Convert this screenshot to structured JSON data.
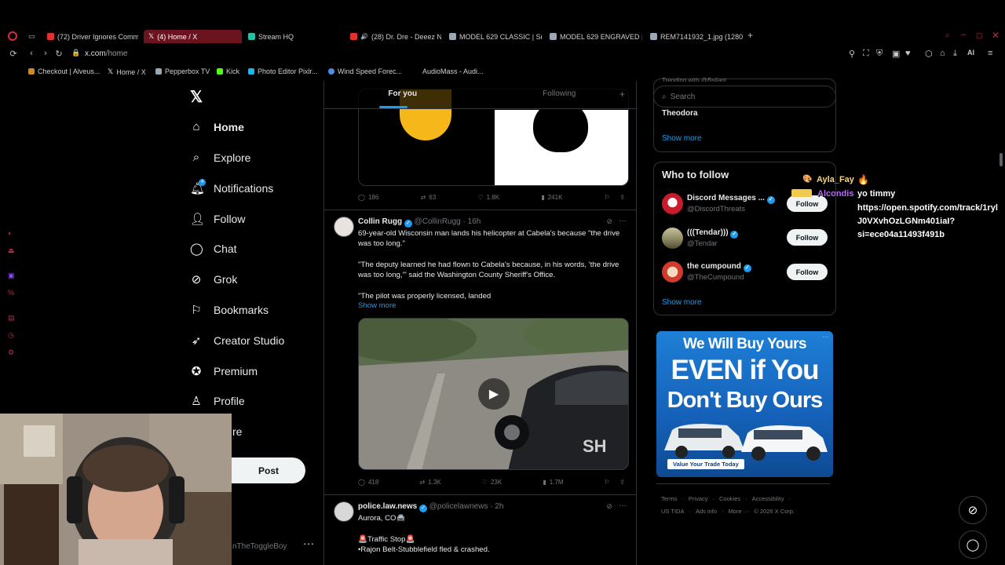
{
  "browser": {
    "tabs": [
      {
        "label": "(72) Driver Ignores Comma",
        "favicon_color": "#e5312d"
      },
      {
        "label": "(4) Home / X",
        "favicon_color": "#ffffff"
      },
      {
        "label": "Stream HQ",
        "favicon_color": "#26c1a5"
      },
      {
        "label": "(28) Dr. Dre - Deeez N",
        "favicon_color": "#e5312d"
      },
      {
        "label": "MODEL 629 CLASSIC | Sm",
        "favicon_color": "#9aa7b5"
      },
      {
        "label": "MODEL 629 ENGRAVED | S",
        "favicon_color": "#9aa7b5"
      },
      {
        "label": "REM7141932_1.jpg (1280×7",
        "favicon_color": "#9aa7b5"
      }
    ],
    "new_tab": "+",
    "address_host": "x.com",
    "address_path": "/home",
    "bookmarks": [
      {
        "label": "Checkout | Alveus...",
        "favicon_color": "#c98a2b"
      },
      {
        "label": "Home / X",
        "favicon_color": "#ffffff"
      },
      {
        "label": "Pepperbox TV",
        "favicon_color": "#9aa7b5"
      },
      {
        "label": "Kick",
        "favicon_color": "#53fc18"
      },
      {
        "label": "Photo Editor Pixlr...",
        "favicon_color": "#1bb5e8"
      },
      {
        "label": "Wind Speed Forec...",
        "favicon_color": "#4a90e2"
      },
      {
        "label": "AudioMass - Audi...",
        "favicon_color": "#000000"
      }
    ],
    "ai_label": "AI"
  },
  "nav": {
    "items": [
      {
        "label": "Home",
        "icon": "home-icon"
      },
      {
        "label": "Explore",
        "icon": "search-icon"
      },
      {
        "label": "Notifications",
        "icon": "bell-icon"
      },
      {
        "label": "Follow",
        "icon": "add-user-icon"
      },
      {
        "label": "Chat",
        "icon": "chat-icon"
      },
      {
        "label": "Grok",
        "icon": "grok-icon"
      },
      {
        "label": "Bookmarks",
        "icon": "bookmark-icon"
      },
      {
        "label": "Creator Studio",
        "icon": "rocket-icon"
      },
      {
        "label": "Premium",
        "icon": "verified-icon"
      },
      {
        "label": "Profile",
        "icon": "person-icon"
      }
    ],
    "more_partial": "re",
    "notifications_badge": "4",
    "post_label": "Post",
    "profile_handle_partial": "nTheToggleBoy",
    "profile_more": "···"
  },
  "feed": {
    "tabs": [
      "For you",
      "Following"
    ],
    "plus": "+",
    "tweet0": {
      "replies": "186",
      "reposts": "63",
      "likes": "1.8K",
      "views": "241K"
    },
    "tweet1": {
      "name": "Collin Rugg",
      "handle": "@CollinRugg",
      "time": "· 16h",
      "p1": "69-year-old Wisconsin man lands his helicopter at Cabela's because \"the drive was too long.\"",
      "p2": "\"The deputy learned he had flown to Cabela's because, in his words, 'the drive was too long,'\" said the Washington County Sheriff's Office.",
      "p3": "\"The pilot was properly licensed, landed",
      "show_more": "Show more",
      "replies": "418",
      "reposts": "1.3K",
      "likes": "23K",
      "views": "1.7M"
    },
    "tweet2": {
      "name": "police.law.news",
      "handle": "@policelawnews",
      "time": "· 2h",
      "line1": "Aurora, CO🚔",
      "line2": "🚨Traffic Stop🚨",
      "line3": "•Rajon Belt-Stubblefield fled & crashed."
    }
  },
  "sidebar": {
    "search_placeholder": "Search",
    "trend_name": "Theodora",
    "trend_partial": "Trending with @Bsilant",
    "show_more": "Show more",
    "who_to_follow": "Who to follow",
    "follow_label": "Follow",
    "suggestions": [
      {
        "name": "Discord Messages ...",
        "handle": "@DiscordThreats",
        "avatar_color": "#c81b2b"
      },
      {
        "name": "(((Tendar)))",
        "handle": "@Tendar",
        "avatar_color": "#8c8a62"
      },
      {
        "name": "the cumpound",
        "handle": "@TheCumpound",
        "avatar_color": "#d23a2a"
      }
    ],
    "ad": {
      "line1": "We Will Buy Yours",
      "line2": "EVEN if You",
      "line3": "Don't Buy Ours",
      "cta": "Value Your Trade Today"
    },
    "footer1": [
      "Terms",
      "·",
      "Privacy",
      "·",
      "Cookies",
      "·",
      "Accessibility",
      "·"
    ],
    "footer2": [
      "US TIDA",
      "·",
      "Ads info",
      "·",
      "More ···",
      "© 2026 X Corp."
    ]
  },
  "chat": {
    "user1": "Ayla_Fay",
    "user2": "Alcondis",
    "message": "yo timmy",
    "link1": "https://open.spotify.com/track/1ryl",
    "link2": "J0VXvhOzLGNm401iaI?",
    "link3": "si=ece04a11493f491b"
  },
  "colors": {
    "accent": "#1d9bf0",
    "opera_red": "#b23347"
  }
}
